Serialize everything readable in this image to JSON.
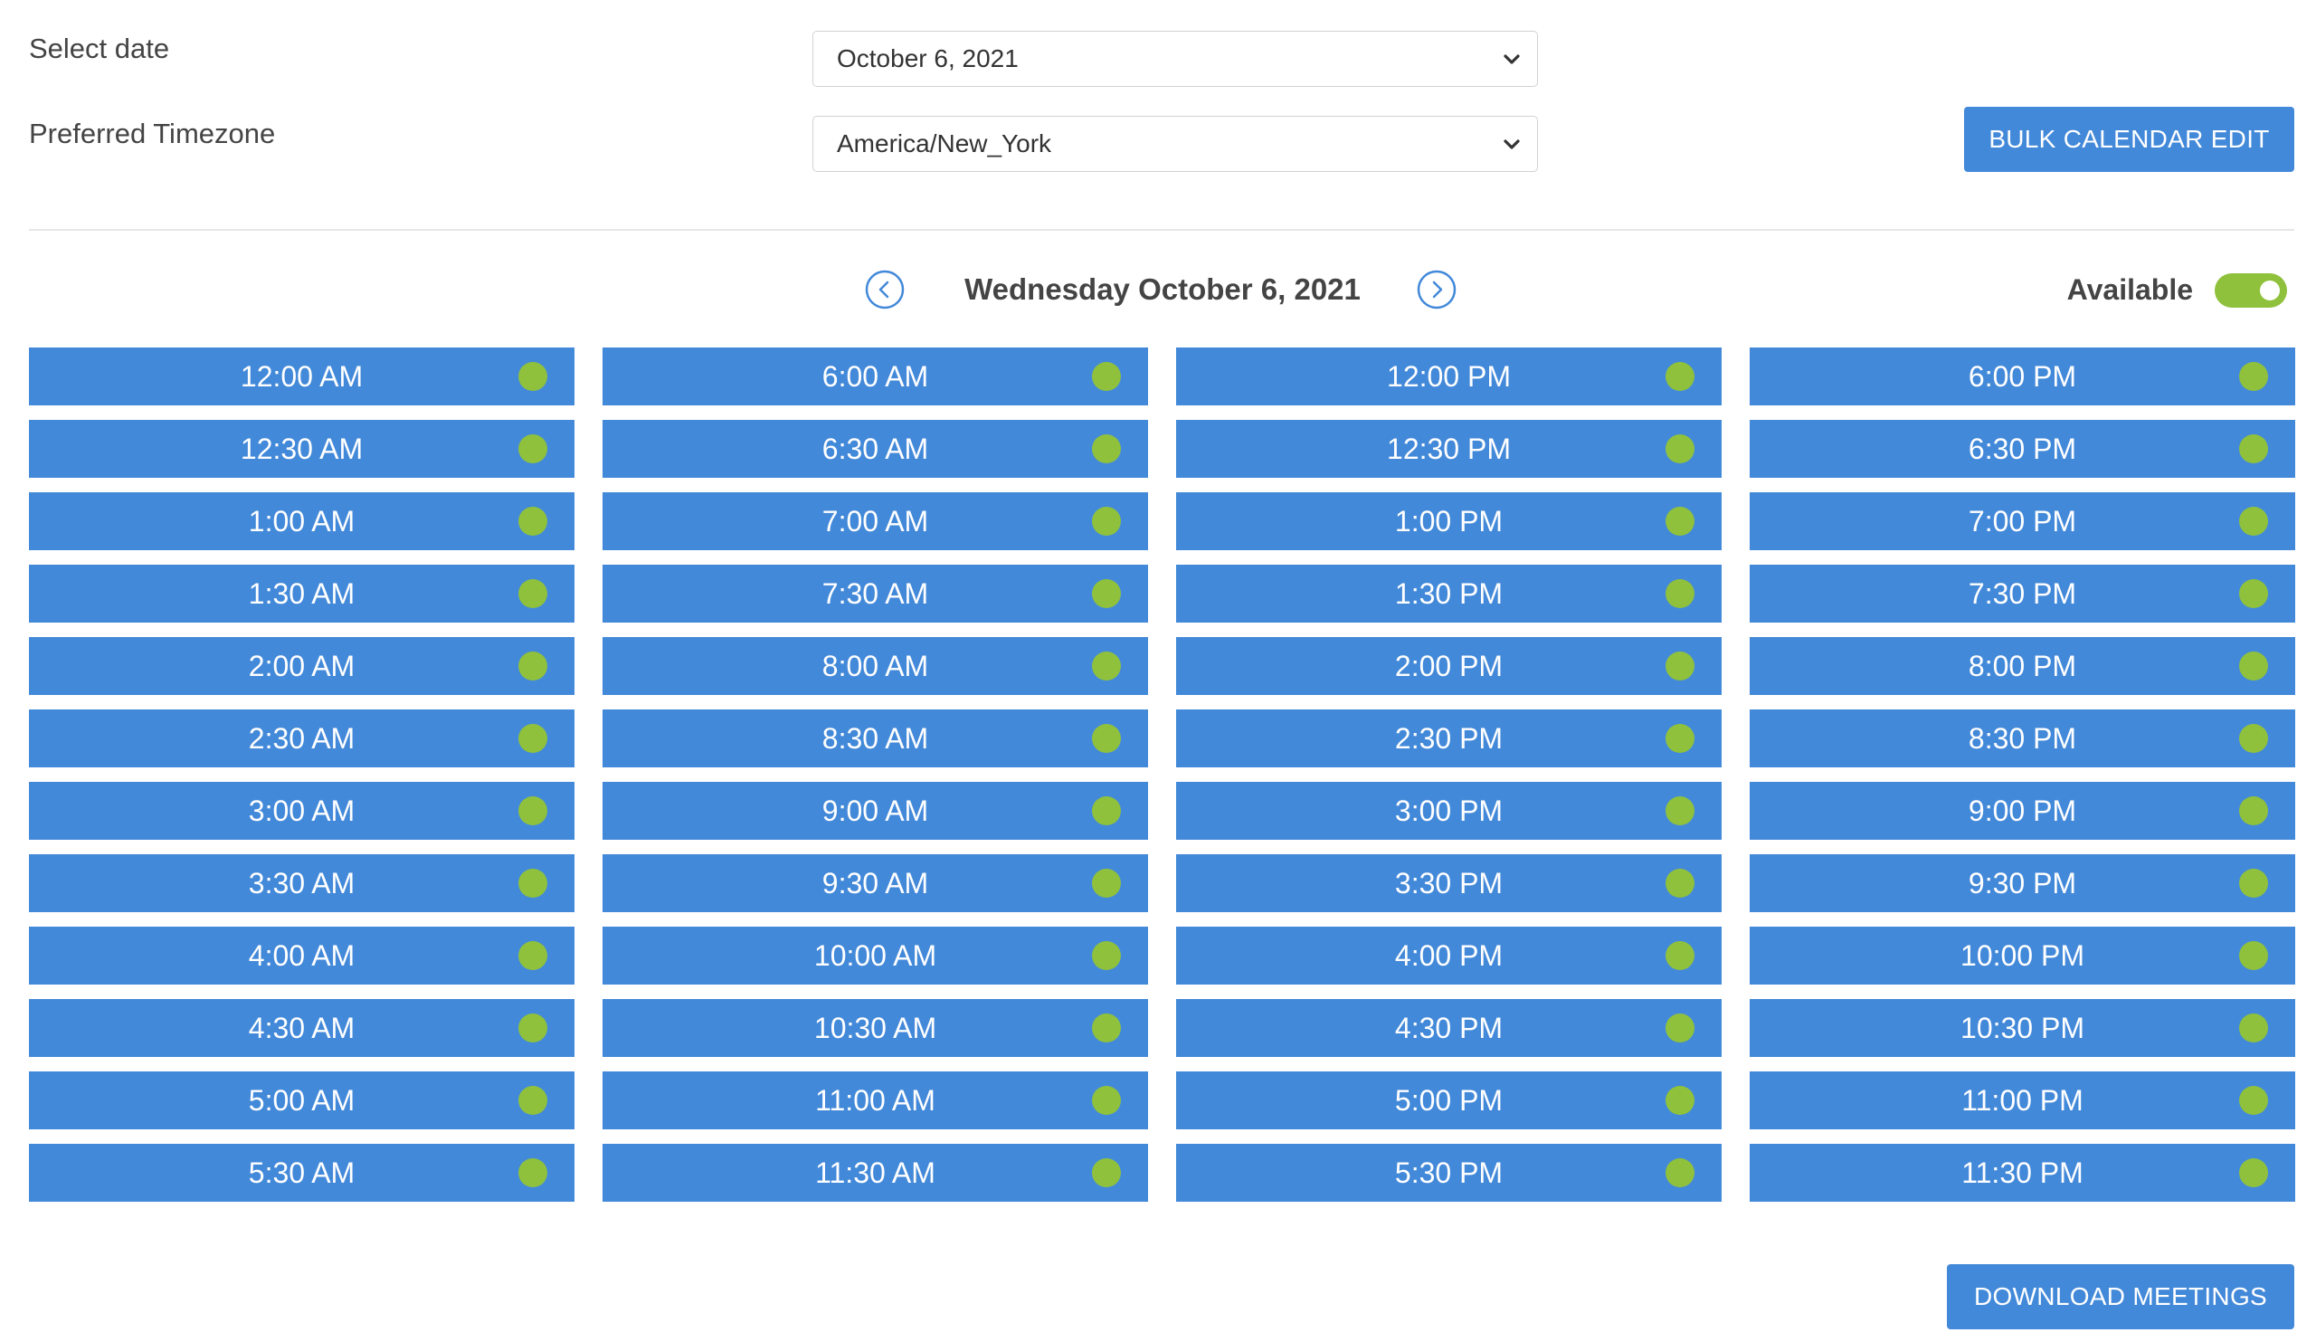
{
  "controls": {
    "date_label": "Select date",
    "date_value": "October 6, 2021",
    "timezone_label": "Preferred Timezone",
    "timezone_value": "America/New_York",
    "bulk_edit_label": "BULK CALENDAR EDIT"
  },
  "day_nav": {
    "title": "Wednesday October 6, 2021",
    "prev_icon": "chevron-left-circle-icon",
    "next_icon": "chevron-right-circle-icon"
  },
  "availability": {
    "label": "Available",
    "enabled": true
  },
  "colors": {
    "slot_background": "#4389d9",
    "available_indicator": "#8fc13c",
    "toggle_on": "#8fc13c"
  },
  "slots": [
    [
      "12:00 AM",
      "12:30 AM",
      "1:00 AM",
      "1:30 AM",
      "2:00 AM",
      "2:30 AM",
      "3:00 AM",
      "3:30 AM",
      "4:00 AM",
      "4:30 AM",
      "5:00 AM",
      "5:30 AM"
    ],
    [
      "6:00 AM",
      "6:30 AM",
      "7:00 AM",
      "7:30 AM",
      "8:00 AM",
      "8:30 AM",
      "9:00 AM",
      "9:30 AM",
      "10:00 AM",
      "10:30 AM",
      "11:00 AM",
      "11:30 AM"
    ],
    [
      "12:00 PM",
      "12:30 PM",
      "1:00 PM",
      "1:30 PM",
      "2:00 PM",
      "2:30 PM",
      "3:00 PM",
      "3:30 PM",
      "4:00 PM",
      "4:30 PM",
      "5:00 PM",
      "5:30 PM"
    ],
    [
      "6:00 PM",
      "6:30 PM",
      "7:00 PM",
      "7:30 PM",
      "8:00 PM",
      "8:30 PM",
      "9:00 PM",
      "9:30 PM",
      "10:00 PM",
      "10:30 PM",
      "11:00 PM",
      "11:30 PM"
    ]
  ],
  "footer": {
    "download_label": "DOWNLOAD MEETINGS"
  }
}
